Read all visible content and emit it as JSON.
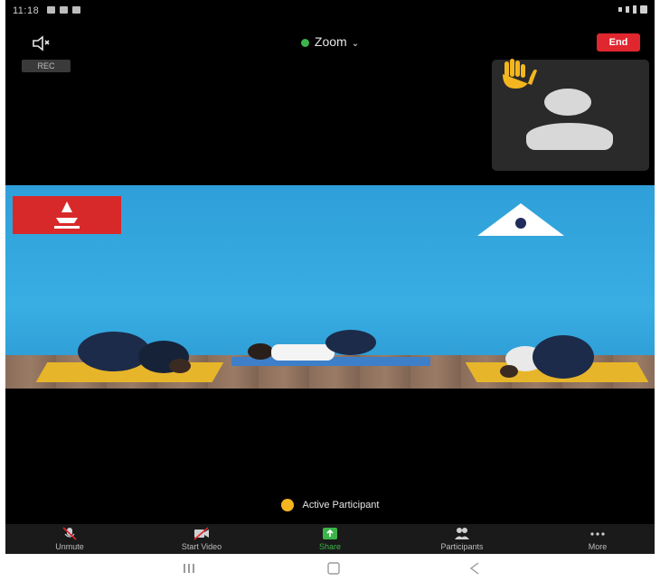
{
  "status_bar": {
    "time": "11:18",
    "right_text": ""
  },
  "meeting": {
    "title": "Zoom"
  },
  "top_bar": {
    "end_label": "End",
    "rec_badge": "REC"
  },
  "active_speaker": {
    "name": "Active Participant"
  },
  "toolbar": {
    "items": [
      {
        "label": "Unmute",
        "icon": "microphone-muted-icon"
      },
      {
        "label": "Start Video",
        "icon": "video-off-icon"
      },
      {
        "label": "Share",
        "icon": "share-screen-icon"
      },
      {
        "label": "Participants",
        "icon": "participants-icon"
      },
      {
        "label": "More",
        "icon": "more-icon"
      }
    ]
  },
  "colors": {
    "end": "#e0262f",
    "share": "#3bb54a",
    "background": "#000000"
  }
}
